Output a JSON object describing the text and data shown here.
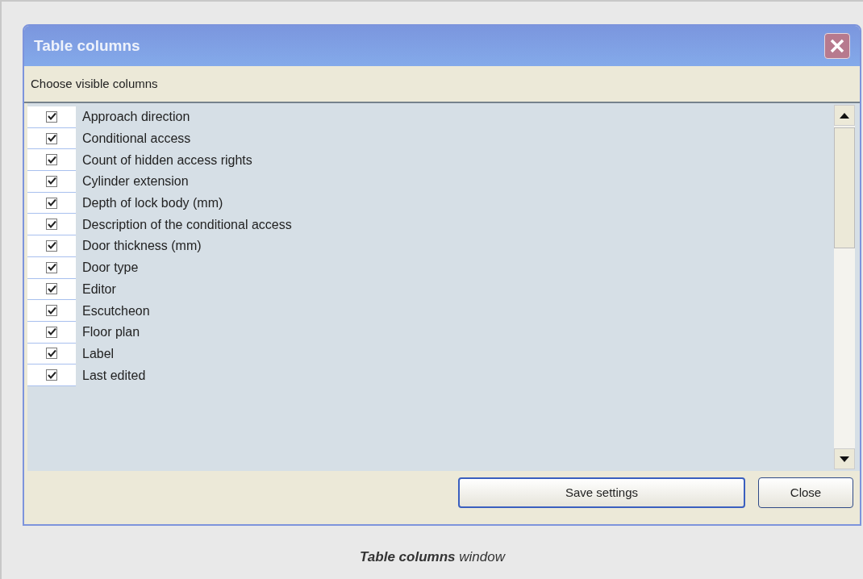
{
  "window": {
    "title": "Table columns"
  },
  "prompt": "Choose visible columns",
  "columns": [
    {
      "label": "Approach direction",
      "checked": true
    },
    {
      "label": "Conditional access",
      "checked": true
    },
    {
      "label": "Count of hidden access rights",
      "checked": true
    },
    {
      "label": "Cylinder extension",
      "checked": true
    },
    {
      "label": "Depth of lock body (mm)",
      "checked": true
    },
    {
      "label": "Description of the conditional access",
      "checked": true
    },
    {
      "label": "Door thickness (mm)",
      "checked": true
    },
    {
      "label": "Door type",
      "checked": true
    },
    {
      "label": "Editor",
      "checked": true
    },
    {
      "label": "Escutcheon",
      "checked": true
    },
    {
      "label": "Floor plan",
      "checked": true
    },
    {
      "label": "Label",
      "checked": true
    },
    {
      "label": "Last edited",
      "checked": true
    }
  ],
  "buttons": [
    {
      "label": "Save settings",
      "kind": "default"
    },
    {
      "label": "Close",
      "kind": "normal"
    }
  ],
  "caption": "**Table columns** window"
}
